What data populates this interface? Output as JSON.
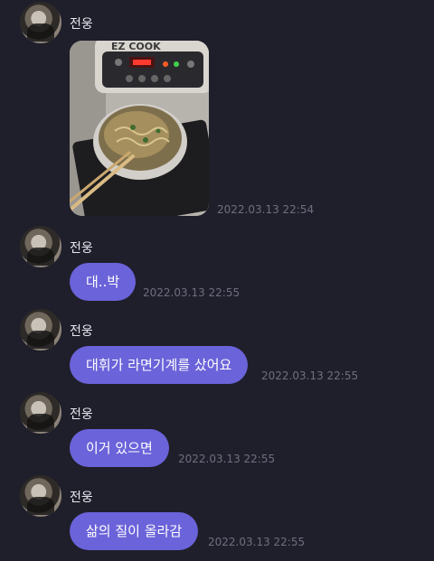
{
  "sender": "전웅",
  "messages": [
    {
      "type": "image",
      "image_alt": "ramen cooked in an EZ COOK induction cooker",
      "brand_text": "EZ COOK",
      "time": "2022.03.13 22:54"
    },
    {
      "type": "text",
      "text": "대..박",
      "time": "2022.03.13 22:55"
    },
    {
      "type": "text",
      "text": "대휘가 라면기계를 샀어요",
      "time": "2022.03.13 22:55"
    },
    {
      "type": "text",
      "text": "이거 있으면",
      "time": "2022.03.13 22:55"
    },
    {
      "type": "text",
      "text": "삶의 질이 올라감",
      "time": "2022.03.13 22:55"
    }
  ],
  "colors": {
    "background": "#1f1f2b",
    "bubble": "#6b63d9",
    "timestamp": "#6e6e80",
    "name": "#e7e7ef"
  }
}
